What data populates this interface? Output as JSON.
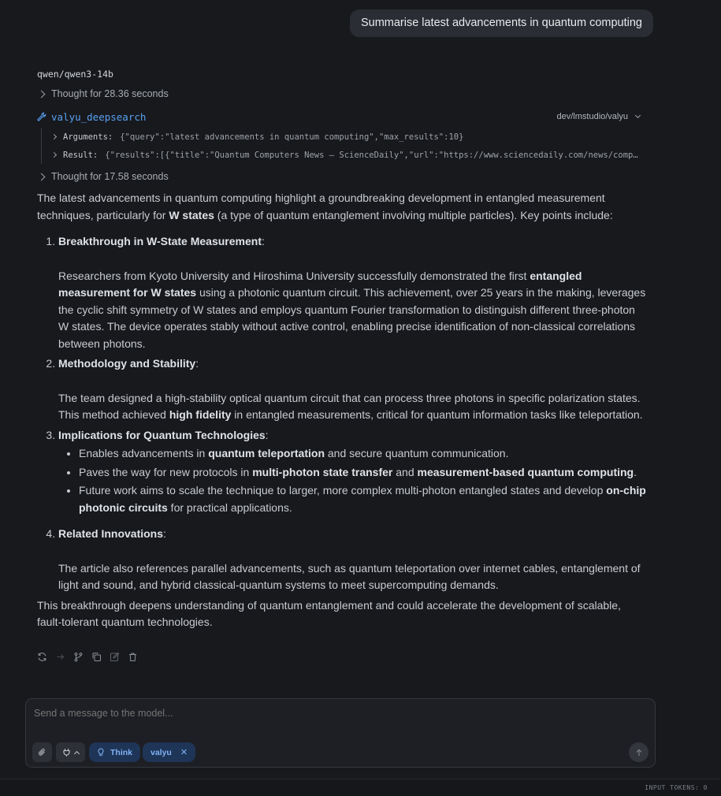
{
  "user_message": "Summarise latest advancements in quantum computing",
  "model": "qwen/qwen3-14b",
  "thought_1": "Thought for 28.36 seconds",
  "tool_call": {
    "name": "valyu_deepsearch",
    "source": "dev/lmstudio/valyu",
    "arguments_label": "Arguments:",
    "arguments_value": "{\"query\":\"latest advancements in quantum computing\",\"max_results\":10}",
    "result_label": "Result:",
    "result_value": "{\"results\":[{\"title\":\"Quantum Computers News — ScienceDaily\",\"url\":\"https://www.sciencedaily.com/news/computers…"
  },
  "thought_2": "Thought for 17.58 seconds",
  "answer": {
    "intro_1": "The latest advancements in quantum computing highlight a groundbreaking development in entangled measurement techniques, particularly for ",
    "intro_bold": "W states",
    "intro_2": " (a type of quantum entanglement involving multiple particles). Key points include:",
    "item1_title": "Breakthrough in W-State Measurement",
    "item1_a": "Researchers from Kyoto University and Hiroshima University successfully demonstrated the first ",
    "item1_b": "entangled measurement for W states",
    "item1_c": " using a photonic quantum circuit. This achievement, over 25 years in the making, leverages the cyclic shift symmetry of W states and employs quantum Fourier transformation to distinguish different three-photon W states. The device operates stably without active control, enabling precise identification of non-classical correlations between photons.",
    "item2_title": "Methodology and Stability",
    "item2_a": "The team designed a high-stability optical quantum circuit that can process three photons in specific polarization states. This method achieved ",
    "item2_b": "high fidelity",
    "item2_c": " in entangled measurements, critical for quantum information tasks like teleportation.",
    "item3_title": "Implications for Quantum Technologies",
    "b1_a": "Enables advancements in ",
    "b1_b": "quantum teleportation",
    "b1_c": " and secure quantum communication.",
    "b2_a": "Paves the way for new protocols in ",
    "b2_b": "multi-photon state transfer",
    "b2_c": " and ",
    "b2_d": "measurement-based quantum computing",
    "b2_e": ".",
    "b3_a": "Future work aims to scale the technique to larger, more complex multi-photon entangled states and develop ",
    "b3_b": "on-chip photonic circuits",
    "b3_c": " for practical applications.",
    "item4_title": "Related Innovations",
    "item4_a": "The article also references parallel advancements, such as quantum teleportation over internet cables, entanglement of light and sound, and hybrid classical-quantum systems to meet supercomputing demands.",
    "conclusion": "This breakthrough deepens understanding of quantum entanglement and could accelerate the development of scalable, fault-tolerant quantum technologies."
  },
  "composer": {
    "placeholder": "Send a message to the model...",
    "think_label": "Think",
    "tool_chip_label": "valyu"
  },
  "footer": {
    "input_tokens": "INPUT TOKENS:  0"
  },
  "colors": {
    "background": "#17191d",
    "accent_blue": "#5aa0f0",
    "pill_bg": "#1f3557"
  }
}
